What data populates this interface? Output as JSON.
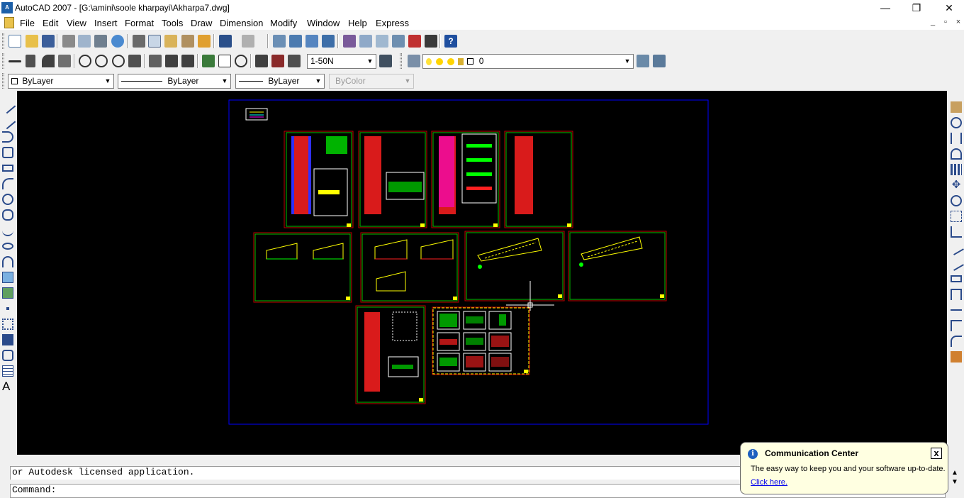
{
  "window": {
    "title": "AutoCAD 2007 - [G:\\amini\\soole kharpayi\\Akharpa7.dwg]",
    "controls": {
      "minimize": "—",
      "restore": "❐",
      "close": "✕"
    }
  },
  "menubar": {
    "items": [
      "File",
      "Edit",
      "View",
      "Insert",
      "Format",
      "Tools",
      "Draw",
      "Dimension",
      "Modify",
      "Window",
      "Help",
      "Express"
    ],
    "doc_controls": {
      "minimize": "_",
      "restore": "▫",
      "close": "×"
    }
  },
  "toolbar_styles": {
    "dimstyle_value": "1-50N",
    "layer_value": "0"
  },
  "properties_toolbar": {
    "color": "ByLayer",
    "linetype": "ByLayer",
    "lineweight": "ByLayer",
    "plotstyle": "ByColor"
  },
  "command": {
    "history_line": "or Autodesk licensed application.",
    "prompt": "Command:"
  },
  "balloon": {
    "title": "Communication Center",
    "message": "The easy way to keep you and your software up-to-date.",
    "link": "Click here.",
    "close_label": "x"
  },
  "colors": {
    "canvas_bg": "#000000",
    "frame_outer": "#c00000",
    "frame_inner": "#00c000",
    "layout_border": "#0000ff",
    "drawing_red": "#ff2020",
    "drawing_yellow": "#ffff00",
    "drawing_green": "#00ff00",
    "drawing_magenta": "#ff00ff",
    "drawing_cyan": "#00ffff"
  }
}
